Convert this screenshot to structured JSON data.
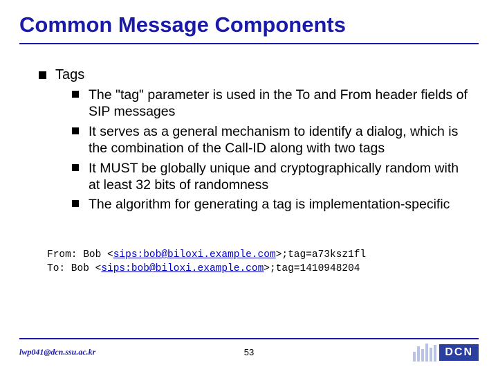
{
  "title": "Common Message Components",
  "top": {
    "label": "Tags",
    "items": [
      "The \"tag\" parameter is used in the To and From header fields of SIP messages",
      "It serves as a general mechanism to identify a dialog, which is the combination of the Call-ID along with two tags",
      "It MUST be globally unique and cryptographically random with at least 32 bits of randomness",
      "The algorithm for generating a tag is implementation-specific"
    ]
  },
  "example": {
    "from_label": "From: Bob <",
    "from_uri": "sips:bob@biloxi.example.com",
    "from_tail": ">;tag=a73ksz1fl",
    "to_label": "To: Bob <",
    "to_uri": "sips:bob@biloxi.example.com",
    "to_tail": ">;tag=1410948204"
  },
  "footer": {
    "email": "lwp041@dcn.ssu.ac.kr",
    "page": "53",
    "logo": "DCN"
  }
}
